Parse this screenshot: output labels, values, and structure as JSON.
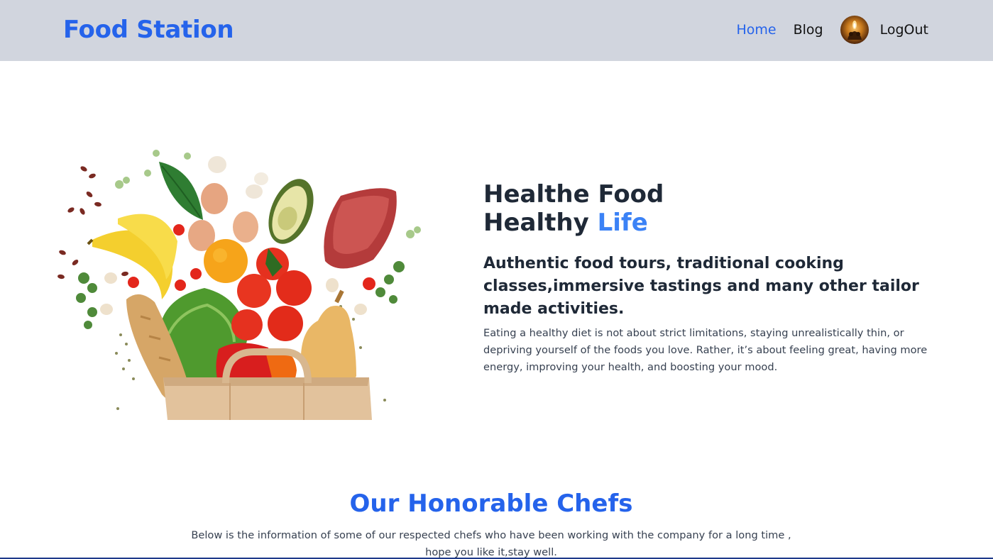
{
  "navbar": {
    "brand": "Food Station",
    "links": [
      {
        "label": "Home",
        "active": true
      },
      {
        "label": "Blog",
        "active": false
      }
    ],
    "avatar_icon": "user-avatar",
    "logout_label": "LogOut",
    "accent_color": "#2563eb",
    "background_color": "#d1d5de"
  },
  "hero": {
    "title_line1": "Healthe Food",
    "title_line2_prefix": "Healthy ",
    "title_line2_accent": "Life",
    "subtitle": "Authentic food tours, traditional cooking classes,immersive tastings and many other tailor made activities.",
    "body": "Eating a healthy diet is not about strict limitations, staying unrealistically thin, or depriving yourself of the foods you love. Rather, it’s about feeling great, having more energy, improving your health, and boosting your mood.",
    "image_icon": "grocery-bag-illustration"
  },
  "chefs": {
    "title": "Our Honorable Chefs",
    "description_line1": "Below is the information of some of our respected chefs who have been working with the company for a long time ,",
    "description_line2": "hope you like it,stay well."
  }
}
